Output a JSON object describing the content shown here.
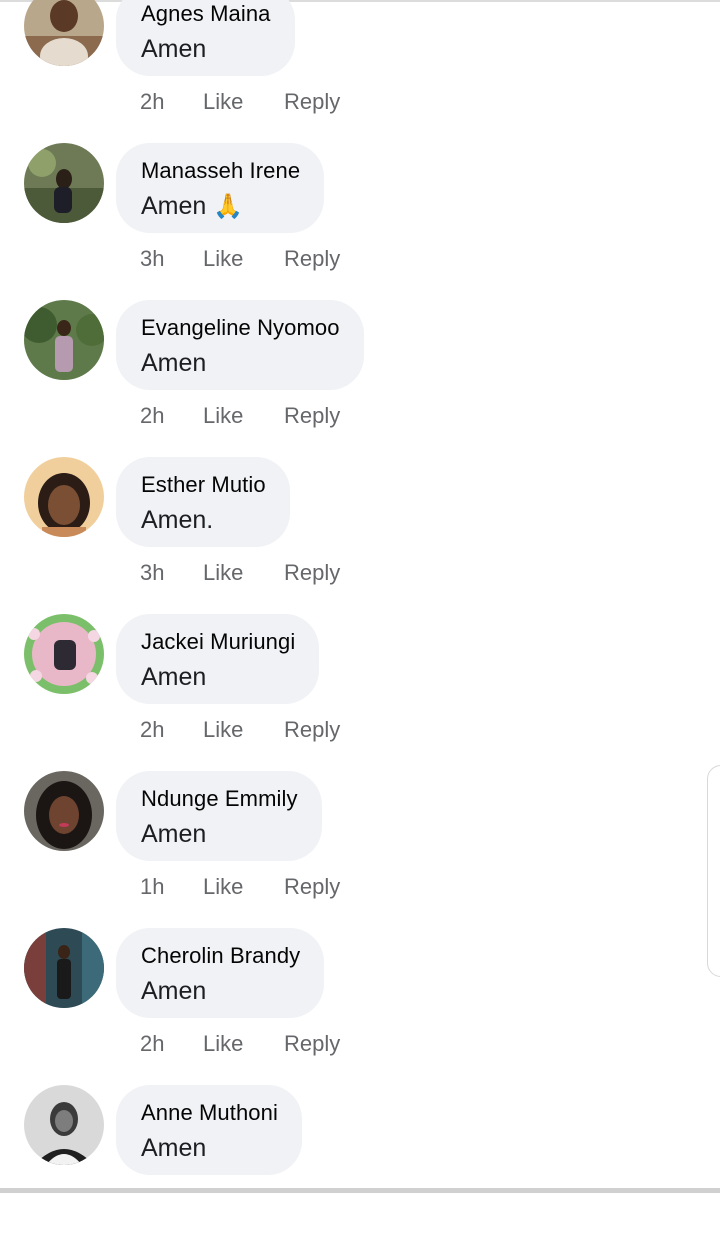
{
  "comments": [
    {
      "author": "Agnes Maina",
      "text": "Amen",
      "time": "2h",
      "like": "Like",
      "reply": "Reply",
      "avatar": "avatar-agnes"
    },
    {
      "author": "Manasseh Irene",
      "text": "Amen",
      "emoji": "🙏",
      "time": "3h",
      "like": "Like",
      "reply": "Reply",
      "avatar": "avatar-manasseh"
    },
    {
      "author": "Evangeline Nyomoo",
      "text": "Amen",
      "time": "2h",
      "like": "Like",
      "reply": "Reply",
      "avatar": "avatar-evangeline"
    },
    {
      "author": "Esther Mutio",
      "text": "Amen.",
      "time": "3h",
      "like": "Like",
      "reply": "Reply",
      "avatar": "avatar-esther"
    },
    {
      "author": "Jackei Muriungi",
      "text": "Amen",
      "time": "2h",
      "like": "Like",
      "reply": "Reply",
      "avatar": "avatar-jackei"
    },
    {
      "author": "Ndunge Emmily",
      "text": "Amen",
      "time": "1h",
      "like": "Like",
      "reply": "Reply",
      "avatar": "avatar-ndunge"
    },
    {
      "author": "Cherolin Brandy",
      "text": "Amen",
      "time": "2h",
      "like": "Like",
      "reply": "Reply",
      "avatar": "avatar-cherolin"
    },
    {
      "author": "Anne Muthoni",
      "text": "Amen",
      "avatar": "avatar-anne"
    }
  ],
  "colors": {
    "bubble": "#f0f2f5",
    "author": "#050505",
    "meta": "#65676b"
  }
}
